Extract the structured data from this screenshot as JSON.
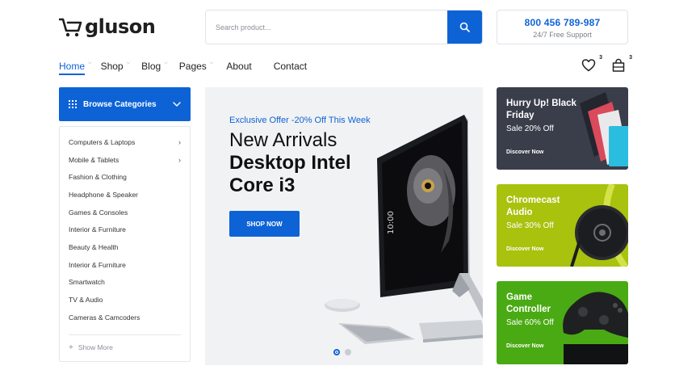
{
  "header": {
    "logo_text": "gluson",
    "search_placeholder": "Search product...",
    "support_phone": "800 456 789-987",
    "support_sub": "24/7 Free Support"
  },
  "nav": {
    "items": [
      {
        "label": "Home",
        "has_dropdown": true,
        "active": true
      },
      {
        "label": "Shop",
        "has_dropdown": true
      },
      {
        "label": "Blog",
        "has_dropdown": true
      },
      {
        "label": "Pages",
        "has_dropdown": true
      },
      {
        "label": "About",
        "has_dropdown": false
      },
      {
        "label": "Contact",
        "has_dropdown": false
      }
    ],
    "wishlist_count": "3",
    "cart_count": "3"
  },
  "categories": {
    "header_label": "Browse Categories",
    "items": [
      {
        "label": "Computers & Laptops",
        "has_submenu": true
      },
      {
        "label": "Mobile & Tablets",
        "has_submenu": true
      },
      {
        "label": "Fashion & Clothing"
      },
      {
        "label": "Headphone & Speaker"
      },
      {
        "label": "Games & Consoles"
      },
      {
        "label": "Interior & Furniture"
      },
      {
        "label": "Beauty & Health"
      },
      {
        "label": "Interior & Furniture"
      },
      {
        "label": "Smartwatch"
      },
      {
        "label": "TV & Audio"
      },
      {
        "label": "Cameras & Camcoders"
      }
    ],
    "show_more_label": "Show More"
  },
  "hero": {
    "offer": "Exclusive Offer -20% Off This Week",
    "line1": "New Arrivals",
    "line2": "Desktop Intel",
    "line3": "Core i3",
    "button_label": "SHOP NOW",
    "slide_count": 2,
    "active_slide": 1
  },
  "promos": [
    {
      "title": "Hurry Up! Black Friday",
      "sale": "Sale 20% Off",
      "link": "Discover Now"
    },
    {
      "title": "Chromecast Audio",
      "sale": "Sale 30% Off",
      "link": "Discover Now"
    },
    {
      "title": "Game Controller",
      "sale": "Sale 60% Off",
      "link": "Discover Now"
    }
  ],
  "colors": {
    "accent": "#0d63d6",
    "promo_dark": "#3a3d4a",
    "promo_lime": "#a8c20e",
    "promo_green": "#4aaa14"
  }
}
